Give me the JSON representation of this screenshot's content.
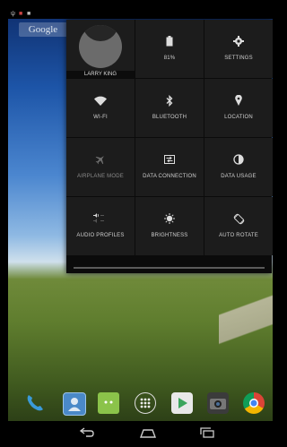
{
  "wallpaper": {
    "google_label": "Google"
  },
  "quick_settings": {
    "user": {
      "name": "LARRY KING"
    },
    "tiles": [
      {
        "label": "81%",
        "icon": "battery-icon"
      },
      {
        "label": "SETTINGS",
        "icon": "gear-icon"
      },
      {
        "label": "WI-FI",
        "icon": "wifi-icon"
      },
      {
        "label": "BLUETOOTH",
        "icon": "bluetooth-icon"
      },
      {
        "label": "LOCATION",
        "icon": "location-pin-icon"
      },
      {
        "label": "AIRPLANE MODE",
        "icon": "airplane-icon"
      },
      {
        "label": "DATA CONNECTION",
        "icon": "data-connection-icon"
      },
      {
        "label": "DATA USAGE",
        "icon": "data-usage-icon"
      },
      {
        "label": "AUDIO PROFILES",
        "icon": "audio-profiles-icon"
      },
      {
        "label": "BRIGHTNESS",
        "icon": "brightness-icon"
      },
      {
        "label": "AUTO ROTATE",
        "icon": "auto-rotate-icon"
      }
    ]
  },
  "colors": {
    "panel_bg": "#0b0b0b",
    "tile_bg": "#1c1c1c",
    "text": "#d6d6d6"
  },
  "dock": {
    "apps": [
      "phone-icon",
      "contacts-icon",
      "messaging-icon",
      "all-apps-icon",
      "play-store-icon",
      "camera-icon",
      "chrome-icon"
    ]
  },
  "navbar": {
    "buttons": [
      "back-icon",
      "home-icon",
      "recents-icon"
    ]
  }
}
